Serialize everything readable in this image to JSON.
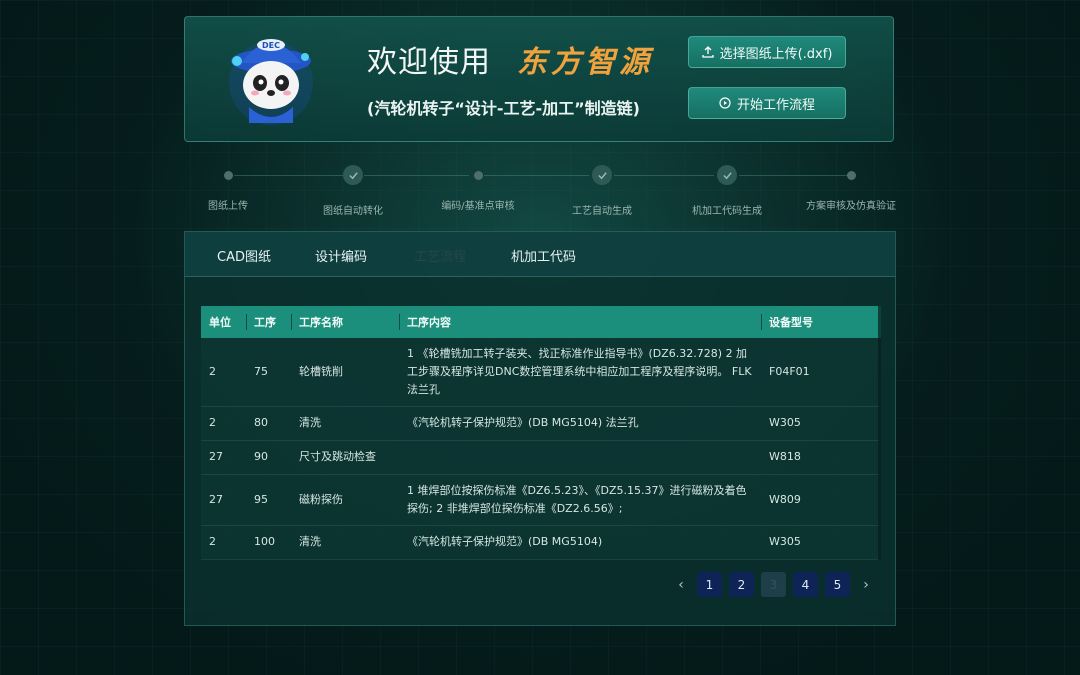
{
  "header": {
    "welcome": "欢迎使用",
    "brand": "东方智源",
    "subtitle": "(汽轮机转子“设计-工艺-加工”制造链)",
    "upload_button": "选择图纸上传(.dxf)",
    "start_button": "开始工作流程",
    "mascot_badge": "DEC"
  },
  "steps": [
    {
      "label": "图纸上传",
      "state": "pending"
    },
    {
      "label": "图纸自动转化",
      "state": "done"
    },
    {
      "label": "编码/基准点审核",
      "state": "pending"
    },
    {
      "label": "工艺自动生成",
      "state": "done"
    },
    {
      "label": "机加工代码生成",
      "state": "done"
    },
    {
      "label": "方案审核及仿真验证",
      "state": "pending"
    }
  ],
  "tabs": [
    "CAD图纸",
    "设计编码",
    "工艺流程",
    "机加工代码"
  ],
  "active_tab": "工艺流程",
  "table": {
    "columns": [
      "单位",
      "工序",
      "工序名称",
      "工序内容",
      "设备型号"
    ],
    "rows": [
      [
        "2",
        "75",
        "轮槽铣削",
        "1 《轮槽铣加工转子装夹、找正标准作业指导书》(DZ6.32.728) 2 加工步骤及程序详见DNC数控管理系统中相应加工程序及程序说明。 FLK法兰孔",
        "F04F01"
      ],
      [
        "2",
        "80",
        "清洗",
        "《汽轮机转子保护规范》(DB MG5104)  法兰孔",
        "W305"
      ],
      [
        "27",
        "90",
        "尺寸及跳动检查",
        "",
        "W818"
      ],
      [
        "27",
        "95",
        "磁粉探伤",
        "1 堆焊部位按探伤标准《DZ6.5.23》、《DZ5.15.37》进行磁粉及着色探伤;  2 非堆焊部位探伤标准《DZ2.6.56》;",
        "W809"
      ],
      [
        "2",
        "100",
        "清洗",
        "《汽轮机转子保护规范》(DB MG5104)",
        "W305"
      ]
    ]
  },
  "pagination": {
    "pages": [
      "1",
      "2",
      "3",
      "4",
      "5"
    ],
    "current": "3",
    "prev": "‹",
    "next": "›"
  },
  "colors": {
    "accent": "#1b8f7c",
    "brand": "#f0a23c",
    "background": "#041a19"
  }
}
